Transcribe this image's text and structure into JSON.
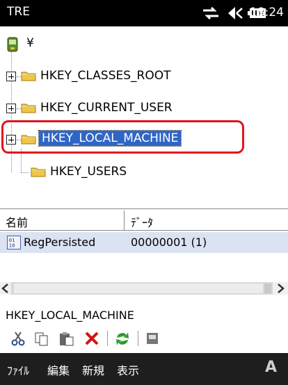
{
  "status_bar": {
    "title": "TRE",
    "time": "18:24",
    "icons": [
      "sync-icon",
      "volume-icon",
      "battery-icon"
    ]
  },
  "tree": {
    "root": {
      "icon": "device-icon",
      "label": "¥"
    },
    "items": [
      {
        "label": "HKEY_CLASSES_ROOT",
        "expandable": true,
        "selected": false
      },
      {
        "label": "HKEY_CURRENT_USER",
        "expandable": true,
        "selected": false
      },
      {
        "label": "HKEY_LOCAL_MACHINE",
        "expandable": true,
        "selected": true
      },
      {
        "label": "HKEY_USERS",
        "expandable": false,
        "selected": false
      }
    ]
  },
  "list": {
    "columns": [
      "名前",
      "ﾃﾞｰﾀ"
    ],
    "rows": [
      {
        "name": "RegPersisted",
        "data": "00000001 (1)"
      }
    ]
  },
  "path": "HKEY_LOCAL_MACHINE",
  "toolbar": [
    "cut-icon",
    "copy-icon",
    "paste-icon",
    "delete-icon",
    "refresh-icon",
    "properties-icon"
  ],
  "menu": {
    "items": [
      "ﾌｧｲﾙ",
      "編集",
      "新規",
      "表示"
    ],
    "input_indicator": "A"
  },
  "colors": {
    "selection": "#2f66c6",
    "highlight_border": "#e0141e",
    "status_bg": "#000000",
    "menubar_bg": "#1e1e1e",
    "list_row_bg": "#dbe3f3"
  }
}
